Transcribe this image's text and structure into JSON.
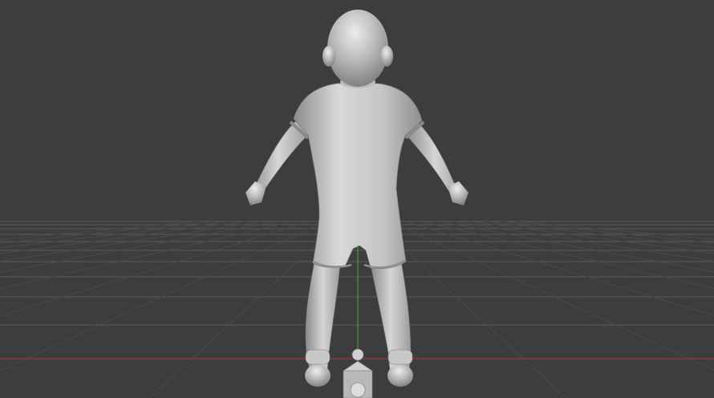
{
  "viewport": {
    "view": "back",
    "projection": "perspective",
    "background_color": "#3d3d3d",
    "grid": {
      "visible": true,
      "line_color": "#5a5a5a",
      "subline_color": "#4a4a4a"
    },
    "axes": {
      "x_axis_color": "#9a3a3a",
      "y_axis_color": "#3f9a3f"
    }
  },
  "scene_objects": [
    {
      "name": "character-mesh",
      "type": "mesh",
      "shading": "solid",
      "material_color": "#b8b8b8"
    },
    {
      "name": "camera-gizmo",
      "type": "camera"
    },
    {
      "name": "lamp-gizmo",
      "type": "lamp"
    }
  ]
}
